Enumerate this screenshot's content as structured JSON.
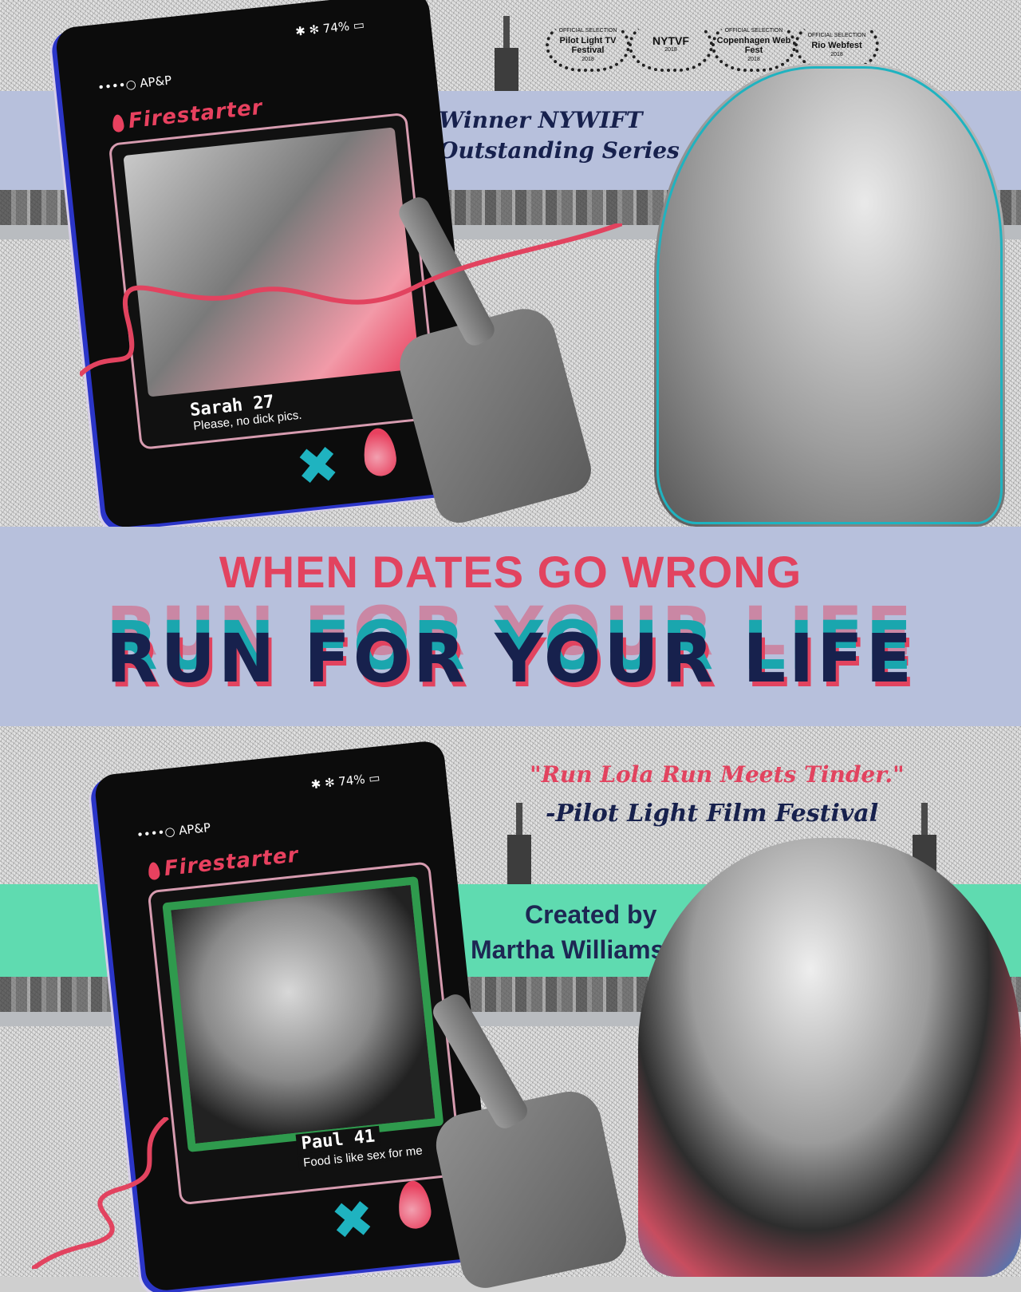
{
  "festivals": [
    {
      "small": "OFFICIAL SELECTION",
      "name": "Pilot Light TV Festival",
      "year": "2018"
    },
    {
      "small": "",
      "name": "NYTVF",
      "year": "2018"
    },
    {
      "small": "OFFICIAL SELECTION",
      "name": "Copenhagen Web Fest",
      "year": "2018"
    },
    {
      "small": "OFFICIAL SELECTION",
      "name": "Rio Webfest",
      "year": "2018"
    }
  ],
  "award": {
    "line1": "Winner NYWIFT",
    "line2": "Outstanding Series"
  },
  "top_phone": {
    "carrier": "••••○ AP&P",
    "battery": "74%",
    "app": "Firestarter",
    "profile_name": "Sarah 27",
    "profile_bio": "Please, no dick pics."
  },
  "headline": {
    "tagline": "WHEN DATES GO WRONG",
    "title": "RUN FOR YOUR LIFE"
  },
  "quote": {
    "text": "\"Run Lola Run Meets Tinder.\"",
    "source": "-Pilot Light Film Festival"
  },
  "bottom_phone": {
    "carrier": "••••○ AP&P",
    "battery": "74%",
    "app": "Firestarter",
    "profile_name": "Paul 41",
    "profile_bio": "Food is like sex for me"
  },
  "credit": {
    "line1": "Created by",
    "line2": "Martha Williams"
  },
  "colors": {
    "pink": "#e2435f",
    "navy": "#17214d",
    "teal": "#1aa6ae",
    "lavender": "#b7c0dc",
    "mint": "#5fdbb0"
  }
}
